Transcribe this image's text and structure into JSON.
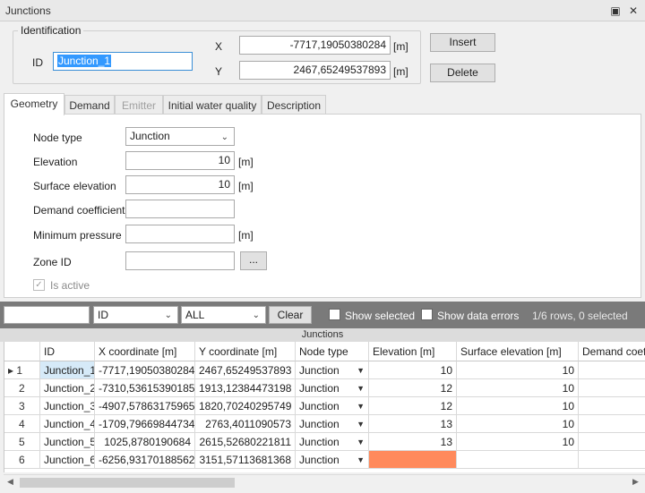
{
  "window": {
    "title": "Junctions"
  },
  "identification": {
    "group_title": "Identification",
    "id_label": "ID",
    "id_value": "Junction_1",
    "x_label": "X",
    "x_value": "-7717,19050380284",
    "y_label": "Y",
    "y_value": "2467,65249537893",
    "unit_m": "[m]",
    "insert_label": "Insert",
    "delete_label": "Delete"
  },
  "tabs": [
    {
      "label": "Geometry"
    },
    {
      "label": "Demand"
    },
    {
      "label": "Emitter"
    },
    {
      "label": "Initial water quality"
    },
    {
      "label": "Description"
    }
  ],
  "geometry": {
    "node_type_label": "Node type",
    "node_type_value": "Junction",
    "elevation_label": "Elevation",
    "elevation_value": "10",
    "surface_elevation_label": "Surface elevation",
    "surface_elevation_value": "10",
    "demand_coefficient_label": "Demand coefficient",
    "minimum_pressure_label": "Minimum pressure",
    "zone_id_label": "Zone ID",
    "browse_label": "...",
    "is_active_label": "Is active",
    "unit_m": "[m]"
  },
  "filter": {
    "search_value": "",
    "column_value": "ID",
    "scope_value": "ALL",
    "clear_label": "Clear",
    "show_selected_label": "Show selected",
    "show_errors_label": "Show data errors",
    "status": "1/6 rows, 0 selected"
  },
  "grid": {
    "caption": "Junctions",
    "columns": [
      "ID",
      "X coordinate [m]",
      "Y coordinate [m]",
      "Node type",
      "Elevation [m]",
      "Surface elevation [m]",
      "Demand coeff"
    ],
    "rows": [
      {
        "n": "1",
        "id": "Junction_1",
        "x": "-7717,19050380284",
        "y": "2467,65249537893",
        "type": "Junction",
        "elev": "10",
        "surf": "10"
      },
      {
        "n": "2",
        "id": "Junction_2",
        "x": "-7310,53615390185",
        "y": "1913,12384473198",
        "type": "Junction",
        "elev": "12",
        "surf": "10"
      },
      {
        "n": "3",
        "id": "Junction_3",
        "x": "-4907,57863175965",
        "y": "1820,70240295749",
        "type": "Junction",
        "elev": "12",
        "surf": "10"
      },
      {
        "n": "4",
        "id": "Junction_4",
        "x": "-1709,79669844734",
        "y": "2763,4011090573",
        "type": "Junction",
        "elev": "13",
        "surf": "10"
      },
      {
        "n": "5",
        "id": "Junction_5",
        "x": "1025,8780190684",
        "y": "2615,52680221811",
        "type": "Junction",
        "elev": "13",
        "surf": "10"
      },
      {
        "n": "6",
        "id": "Junction_6",
        "x": "-6256,93170188562",
        "y": "3151,57113681368",
        "type": "Junction",
        "elev": "",
        "surf": ""
      }
    ]
  }
}
